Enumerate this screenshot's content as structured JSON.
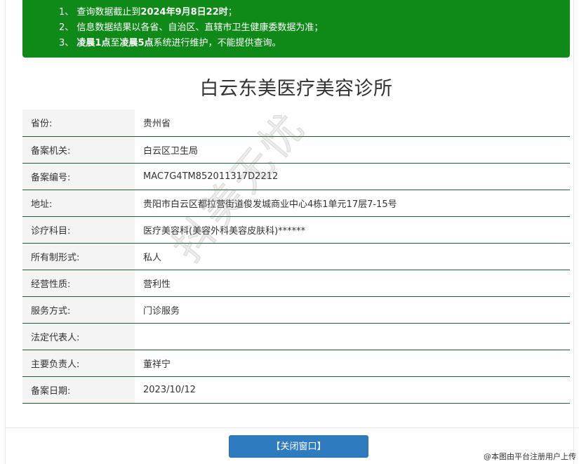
{
  "notice": {
    "line1_prefix": "1、 查询数据截止到",
    "line1_bold": "2024年9月8日22时",
    "line1_suffix": "；",
    "line2": "2、 信息数据结果以各省、自治区、直辖市卫生健康委数据为准；",
    "line3_prefix": "3、 ",
    "line3_bold1": "凌晨1点",
    "line3_mid": "至",
    "line3_bold2": "凌晨5点",
    "line3_suffix": "系统进行维护，不能提供查询。"
  },
  "clinic": {
    "title": "白云东美医疗美容诊所"
  },
  "records": [
    {
      "label": "省份:",
      "value": "贵州省"
    },
    {
      "label": "备案机关:",
      "value": "白云区卫生局"
    },
    {
      "label": "备案编号:",
      "value": "MAC7G4TM852011317D2212"
    },
    {
      "label": "地址:",
      "value": "贵阳市白云区都拉营街道俊发城商业中心4栋1单元17层7-15号"
    },
    {
      "label": "诊疗科目:",
      "value": "医疗美容科(美容外科美容皮肤科)******"
    },
    {
      "label": "所有制形式:",
      "value": "私人"
    },
    {
      "label": "经营性质:",
      "value": "营利性"
    },
    {
      "label": "服务方式:",
      "value": "门诊服务"
    },
    {
      "label": "法定代表人:",
      "value": ""
    },
    {
      "label": "主要负责人:",
      "value": "董祥宁"
    },
    {
      "label": "备案日期:",
      "value": "2023/10/12"
    }
  ],
  "actions": {
    "close_label": "【关闭窗口】"
  },
  "watermark": {
    "text": "抖美无忧"
  },
  "corner_mark": {
    "text": "@本图由平台注册用户上传"
  }
}
